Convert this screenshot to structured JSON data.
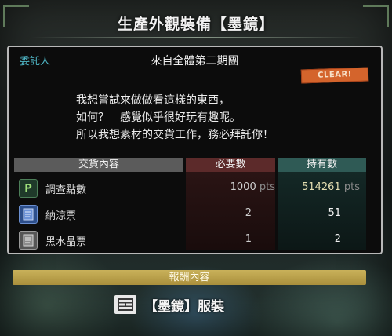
{
  "title": "生產外觀裝備【墨鏡】",
  "client": {
    "label": "委託人",
    "name": "來自全體第二期團"
  },
  "status_badge": "CLEAR!",
  "message_lines": [
    "我想嘗試來做做看這樣的東西，",
    "如何？　感覺似乎很好玩有趣呢。",
    "所以我想素材的交貨工作，務必拜託你！"
  ],
  "table": {
    "headers": {
      "items": "交貨內容",
      "required": "必要數",
      "owned": "持有數"
    },
    "rows": [
      {
        "icon": "research-points-icon",
        "name": "調查點數",
        "required": "1000",
        "required_unit": "pts",
        "owned": "514261",
        "owned_unit": "pts"
      },
      {
        "icon": "blue-ticket-icon",
        "name": "納涼票",
        "required": "2",
        "owned": "51"
      },
      {
        "icon": "gray-ticket-icon",
        "name": "黑水晶票",
        "required": "1",
        "owned": "2"
      }
    ]
  },
  "reward": {
    "header": "報酬內容",
    "item_name": "【墨鏡】服裝",
    "item_icon": "armor-set-icon"
  },
  "colors": {
    "accent_cyan": "#4fb7c7",
    "clear_badge": "#d4642c",
    "reward_bar": "#b89e48",
    "required_col": "#5c2a2a",
    "owned_col": "#2f5a55"
  }
}
